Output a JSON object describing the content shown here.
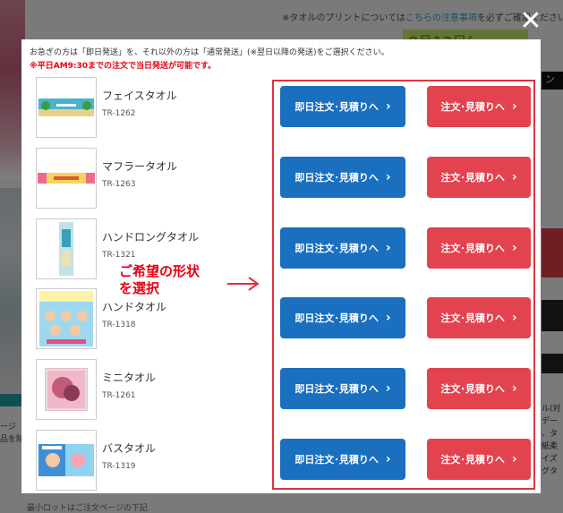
{
  "background": {
    "top_notice_prefix": "※タオルのプリントについては",
    "top_notice_link": "こちらの注意事項",
    "top_notice_suffix": "を必ずご確認ください",
    "banner_text": "8月13日(",
    "right_tab_text": "ン",
    "left_side_text": "ージ\n品を除",
    "right_side_text": "ル(対\nデー\n、タ\n紙柔\nイズ\nグタ",
    "bottom_text": "最小ロットはご注文ページの下記"
  },
  "modal": {
    "notice": "お急ぎの方は「即日発送」を、それ以外の方は「通常発送」(※翌日以降の発送)をご選択ください。",
    "notice_red": "※平日AM9:30までの注文で当日発送が可能です。",
    "close_label": "✕",
    "callout": "ご希望の形状\nを選択",
    "blue_button_label": "即日注文･見積りへ",
    "red_button_label": "注文･見積りへ",
    "chevron": "›",
    "products": [
      {
        "name": "フェイスタオル",
        "code": "TR-1262"
      },
      {
        "name": "マフラータオル",
        "code": "TR-1263"
      },
      {
        "name": "ハンドロングタオル",
        "code": "TR-1321"
      },
      {
        "name": "ハンドタオル",
        "code": "TR-1318"
      },
      {
        "name": "ミニタオル",
        "code": "TR-1261"
      },
      {
        "name": "バスタオル",
        "code": "TR-1319"
      }
    ]
  },
  "colors": {
    "blue": "#1a6fbf",
    "red": "#e2434f",
    "frame": "#e0323d",
    "notice_red": "#e60012"
  }
}
